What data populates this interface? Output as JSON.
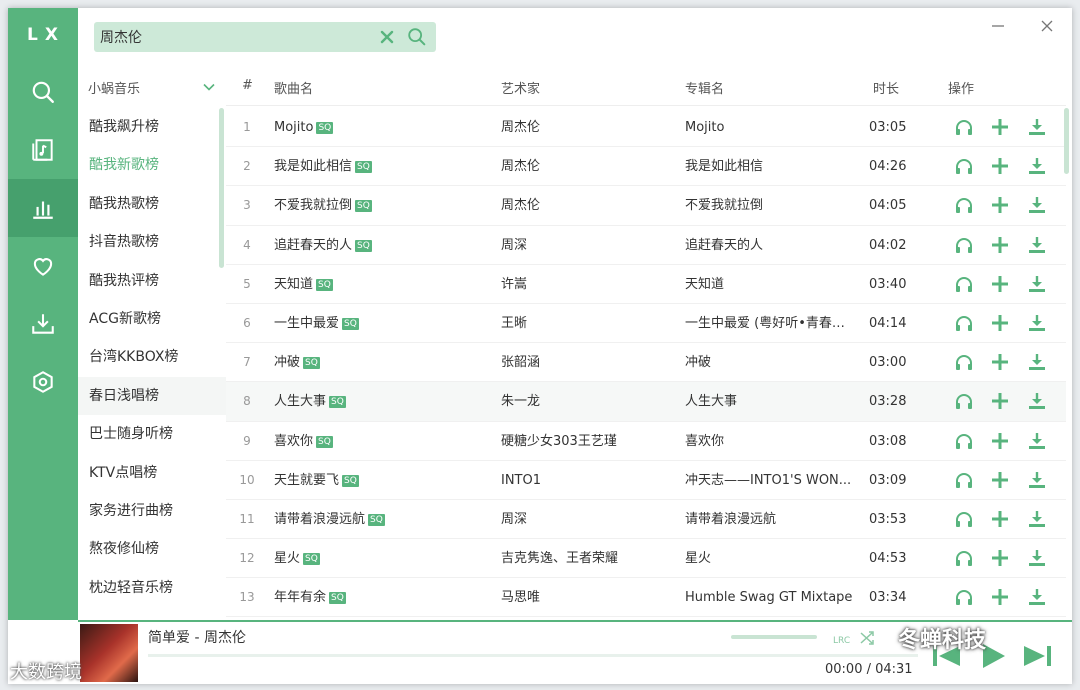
{
  "app": {
    "logo": "LX"
  },
  "nav": [
    {
      "icon": "search-icon"
    },
    {
      "icon": "music-list-icon"
    },
    {
      "icon": "leaderboard-icon",
      "active": true
    },
    {
      "icon": "heart-icon"
    },
    {
      "icon": "download-icon"
    },
    {
      "icon": "settings-icon"
    }
  ],
  "search": {
    "value": "周杰伦"
  },
  "source": {
    "label": "小蜗音乐"
  },
  "boards": [
    "酷我飙升榜",
    "酷我新歌榜",
    "酷我热歌榜",
    "抖音热歌榜",
    "酷我热评榜",
    "ACG新歌榜",
    "台湾KKBOX榜",
    "春日浅唱榜",
    "巴士随身听榜",
    "KTV点唱榜",
    "家务进行曲榜",
    "熬夜修仙榜",
    "枕边轻音乐榜"
  ],
  "active_board": 1,
  "table": {
    "headers": {
      "num": "#",
      "name": "歌曲名",
      "artist": "艺术家",
      "album": "专辑名",
      "duration": "时长",
      "ops": "操作"
    },
    "quality_badge": "SQ",
    "rows": [
      {
        "num": "1",
        "name": "Mojito",
        "artist": "周杰伦",
        "album": "Mojito",
        "duration": "03:05"
      },
      {
        "num": "2",
        "name": "我是如此相信",
        "artist": "周杰伦",
        "album": "我是如此相信",
        "duration": "04:26"
      },
      {
        "num": "3",
        "name": "不爱我就拉倒",
        "artist": "周杰伦",
        "album": "不爱我就拉倒",
        "duration": "04:05"
      },
      {
        "num": "4",
        "name": "追赶春天的人",
        "artist": "周深",
        "album": "追赶春天的人",
        "duration": "04:02"
      },
      {
        "num": "5",
        "name": "天知道",
        "artist": "许嵩",
        "album": "天知道",
        "duration": "03:40"
      },
      {
        "num": "6",
        "name": "一生中最爱",
        "artist": "王晰",
        "album": "一生中最爱 (粤好听•青春重...",
        "duration": "04:14"
      },
      {
        "num": "7",
        "name": "冲破",
        "artist": "张韶涵",
        "album": "冲破",
        "duration": "03:00"
      },
      {
        "num": "8",
        "name": "人生大事",
        "artist": "朱一龙",
        "album": "人生大事",
        "duration": "03:28"
      },
      {
        "num": "9",
        "name": "喜欢你",
        "artist": "硬糖少女303王艺瑾",
        "album": "喜欢你",
        "duration": "03:08"
      },
      {
        "num": "10",
        "name": "天生就要飞",
        "artist": "INTO1",
        "album": "冲天志——INTO1'S WON...",
        "duration": "03:09"
      },
      {
        "num": "11",
        "name": "请带着浪漫远航",
        "artist": "周深",
        "album": "请带着浪漫远航",
        "duration": "03:53"
      },
      {
        "num": "12",
        "name": "星火",
        "artist": "吉克隽逸、王者荣耀",
        "album": "星火",
        "duration": "04:53"
      },
      {
        "num": "13",
        "name": "年年有余",
        "artist": "马思唯",
        "album": "Humble Swag GT Mixtape",
        "duration": "03:34"
      }
    ]
  },
  "player": {
    "title": "简单爱 - 周杰伦",
    "time": "00:00 / 04:31",
    "progress": 0,
    "lyric_label": "LRC"
  },
  "watermarks": {
    "left": "大数跨境",
    "right": "冬蝉科技"
  },
  "colors": {
    "accent": "#58b47e",
    "accent_dark": "#46a06d",
    "search_bg": "#cde9d8"
  }
}
